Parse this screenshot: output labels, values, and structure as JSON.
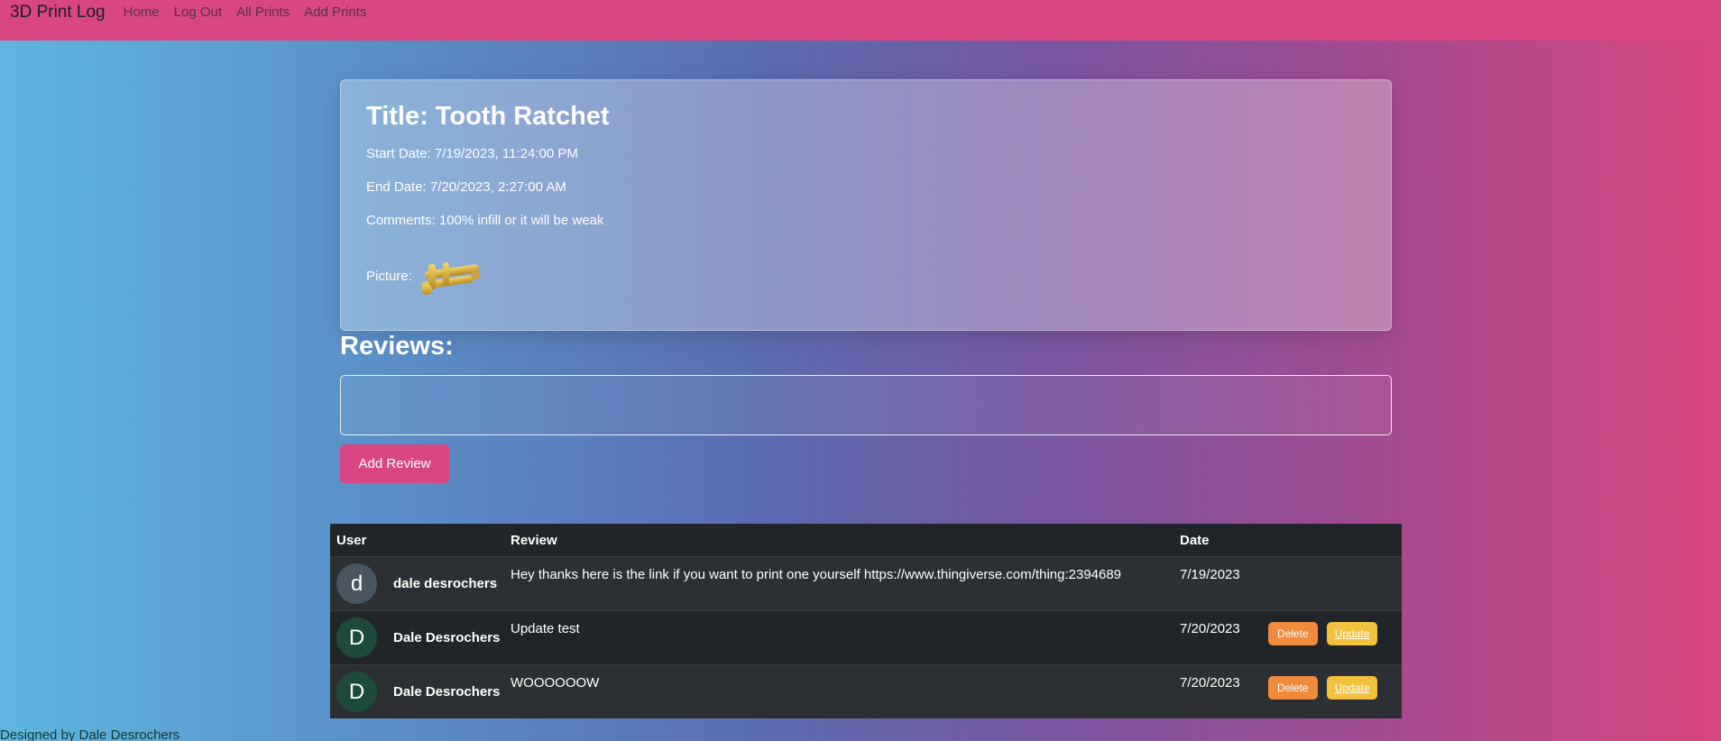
{
  "nav": {
    "brand": "3D Print Log",
    "links": [
      "Home",
      "Log Out",
      "All Prints",
      "Add Prints"
    ]
  },
  "print": {
    "title": "Title: Tooth Ratchet",
    "start": "Start Date: 7/19/2023, 11:24:00 PM",
    "end": "End Date: 7/20/2023, 2:27:00 AM",
    "comments": "Comments: 100% infill or it will be weak",
    "picture_label": "Picture:"
  },
  "reviews": {
    "heading": "Reviews:",
    "input_placeholder": "",
    "add_button": "Add Review",
    "columns": [
      "User",
      "Review",
      "Date"
    ],
    "rows": [
      {
        "initial": "d",
        "avatar_color": "#4a5560",
        "user": "dale desrochers",
        "review": "Hey thanks here is the link if you want to print one yourself https://www.thingiverse.com/thing:2394689",
        "date": "7/19/2023",
        "delete": "",
        "update": ""
      },
      {
        "initial": "D",
        "avatar_color": "#1d4a3a",
        "user": "Dale Desrochers",
        "review": "Update test",
        "date": "7/20/2023",
        "delete": "Delete",
        "update": "Update"
      },
      {
        "initial": "D",
        "avatar_color": "#1d4a3a",
        "user": "Dale Desrochers",
        "review": "WOOOOOOW",
        "date": "7/20/2023",
        "delete": "Delete",
        "update": "Update"
      }
    ]
  },
  "footer": "Designed by Dale Desrochers",
  "colors": {
    "accent": "#d84683",
    "delete": "#f08a3c",
    "update": "#f2c13e"
  }
}
